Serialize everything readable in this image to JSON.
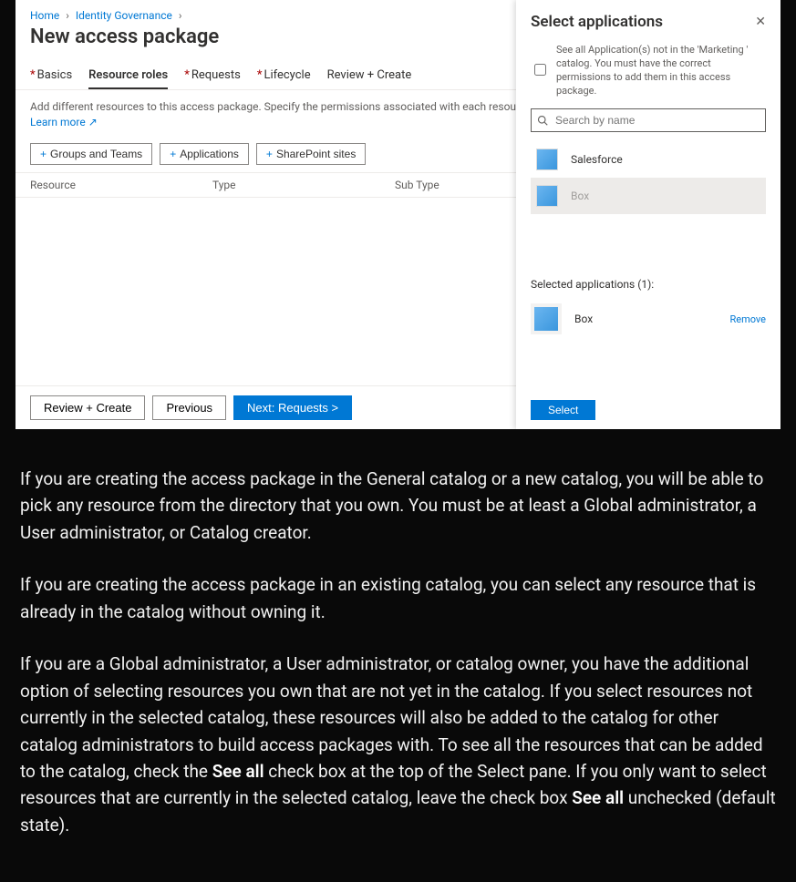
{
  "breadcrumb": {
    "home": "Home",
    "identity_gov": "Identity Governance"
  },
  "page_title": "New access package",
  "tabs": {
    "basics": "Basics",
    "resource_roles": "Resource roles",
    "requests": "Requests",
    "lifecycle": "Lifecycle",
    "review_create": "Review + Create"
  },
  "description": {
    "main": "Add different resources to this access package. Specify the permissions associated with each resource by selecting a role from the drop down list. ",
    "learn_more": "Learn more",
    "ext_icon": "↗"
  },
  "resource_buttons": {
    "groups": "Groups and Teams",
    "applications": "Applications",
    "sharepoint": "SharePoint sites"
  },
  "table_head": {
    "resource": "Resource",
    "type": "Type",
    "subtype": "Sub Type"
  },
  "footer": {
    "review_create": "Review + Create",
    "previous": "Previous",
    "next": "Next: Requests >"
  },
  "panel": {
    "title": "Select applications",
    "see_all_text": "See all Application(s) not in the 'Marketing ' catalog. You must have the correct permissions to add them in this access package.",
    "search_placeholder": "Search by name",
    "apps": {
      "salesforce": "Salesforce",
      "box": "Box"
    },
    "selected_label": "Selected applications (1):",
    "selected_app": "Box",
    "remove": "Remove",
    "select_button": "Select"
  },
  "article": {
    "p1": "If you are creating the access package in the General catalog or a new catalog, you will be able to pick any resource from the directory that you own. You must be at least a Global administrator, a User administrator, or Catalog creator.",
    "p2": "If you are creating the access package in an existing catalog, you can select any resource that is already in the catalog without owning it.",
    "p3a": "If you are a Global administrator, a User administrator, or catalog owner, you have the additional option of selecting resources you own that are not yet in the catalog. If you select resources not currently in the selected catalog, these resources will also be added to the catalog for other catalog administrators to build access packages with. To see all the resources that can be added to the catalog, check the ",
    "p3_strong1": "See all",
    "p3b": " check box at the top of the Select pane. If you only want to select resources that are currently in the selected catalog, leave the check box ",
    "p3_strong2": "See all",
    "p3c": " unchecked (default state)."
  }
}
